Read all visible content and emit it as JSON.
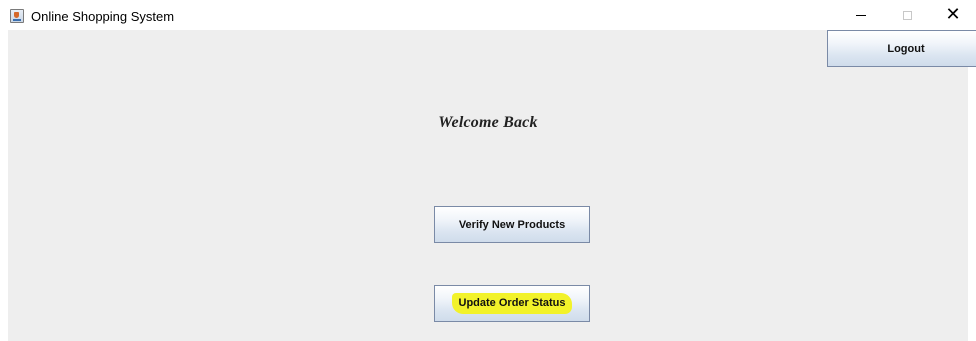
{
  "window": {
    "title": "Online Shopping System",
    "icon": "java-app-icon",
    "controls": {
      "minimize": "minimize-icon",
      "maximize": "maximize-icon",
      "close": "close-icon"
    }
  },
  "main": {
    "logout_label": "Logout",
    "welcome_text": "Welcome Back",
    "verify_label": "Verify New Products",
    "update_label": "Update Order Status"
  },
  "colors": {
    "panel_bg": "#eeeeee",
    "highlight": "#f2f22a",
    "button_border": "#7a8aa6"
  }
}
